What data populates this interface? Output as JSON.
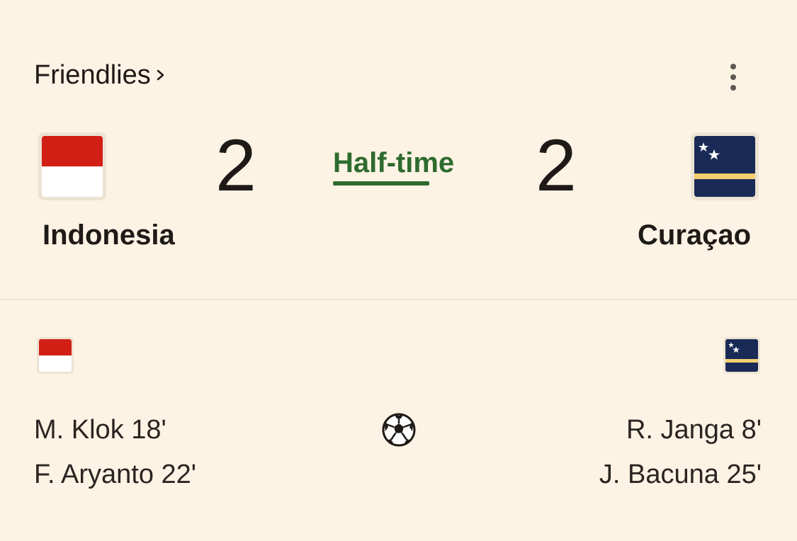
{
  "header": {
    "competition": "Friendlies",
    "chevron": "›",
    "menu_icon": "more-vertical-icon"
  },
  "match": {
    "status": "Half-time",
    "home": {
      "name": "Indonesia",
      "score": "2",
      "flag_colors": [
        "#d21f16",
        "#ffffff"
      ]
    },
    "away": {
      "name": "Curaçao",
      "score": "2",
      "flag_colors": [
        "#1a2a57",
        "#f3cf71",
        "#ffffff"
      ]
    }
  },
  "events": {
    "icon": "soccer-ball-icon",
    "home_scorers": [
      "M. Klok 18'",
      "F. Aryanto 22'"
    ],
    "away_scorers": [
      "R. Janga 8'",
      "J. Bacuna 25'"
    ]
  },
  "colors": {
    "background": "#fdf3e4",
    "status_green": "#2e6b2f",
    "text": "#1f1a17"
  }
}
